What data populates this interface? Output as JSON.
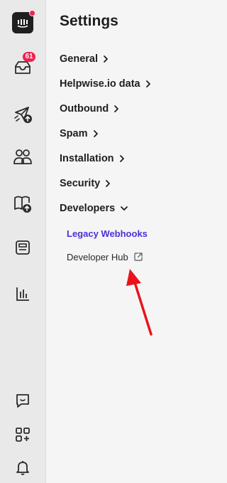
{
  "rail": {
    "icons": [
      {
        "name": "app-logo-icon"
      },
      {
        "name": "inbox-icon",
        "badge": "61"
      },
      {
        "name": "outbound-campaign-icon"
      },
      {
        "name": "contacts-icon"
      },
      {
        "name": "knowledge-base-icon"
      },
      {
        "name": "saved-replies-icon"
      },
      {
        "name": "reports-icon"
      },
      {
        "name": "chat-widget-icon"
      },
      {
        "name": "apps-icon"
      },
      {
        "name": "notifications-bell-icon"
      }
    ]
  },
  "settings": {
    "title": "Settings",
    "items": [
      {
        "label": "General",
        "expanded": false
      },
      {
        "label": "Helpwise.io data",
        "expanded": false
      },
      {
        "label": "Outbound",
        "expanded": false
      },
      {
        "label": "Spam",
        "expanded": false
      },
      {
        "label": "Installation",
        "expanded": false
      },
      {
        "label": "Security",
        "expanded": false
      },
      {
        "label": "Developers",
        "expanded": true
      }
    ],
    "developer_subitems": [
      {
        "label": "Legacy Webhooks",
        "active": true
      },
      {
        "label": "Developer Hub",
        "external": true
      }
    ]
  },
  "colors": {
    "accent": "#4b2fd8",
    "badge": "#f3214f",
    "annotation_arrow": "#e8141a"
  }
}
